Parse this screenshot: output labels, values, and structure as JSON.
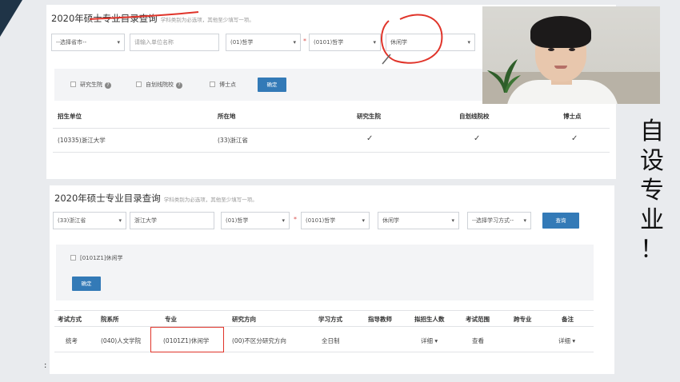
{
  "panel1": {
    "title": "2020年硕士专业目录查询",
    "subtitle": "学科类别为必选项，其他至少填写一项。",
    "province_select": "--选择省市--",
    "unit_input_placeholder": "请输入单位名称",
    "discipline_select": "(01)哲学",
    "subject_select": "(0101)哲学",
    "major_input": "休闲学",
    "checkboxes": [
      {
        "label": "研究生院",
        "help": "?"
      },
      {
        "label": "自划线院校",
        "help": "?"
      },
      {
        "label": "博士点",
        "help": ""
      }
    ],
    "confirm_button": "确定",
    "table": {
      "headers": [
        "招生单位",
        "所在地",
        "研究生院",
        "自划线院校",
        "博士点"
      ],
      "rows": [
        {
          "unit": "(10335)浙江大学",
          "location": "(33)浙江省",
          "c1": "✓",
          "c2": "✓",
          "c3": "✓"
        }
      ]
    }
  },
  "panel2": {
    "title": "2020年硕士专业目录查询",
    "subtitle": "学科类别为必选项，其他至少填写一项。",
    "province_select": "(33)浙江省",
    "unit_input": "浙江大学",
    "discipline_select": "(01)哲学",
    "subject_select": "(0101)哲学",
    "major_select": "休闲学",
    "study_mode_select": "--选择学习方式--",
    "query_button": "查询",
    "major_checkbox": "[0101Z1]休闲学",
    "confirm_button": "确定",
    "table": {
      "headers": [
        "考试方式",
        "院系所",
        "专业",
        "研究方向",
        "学习方式",
        "指导教师",
        "拟招生人数",
        "考试范围",
        "跨专业",
        "备注"
      ],
      "row": {
        "exam": "统考",
        "dept": "(040)人文学院",
        "major": "(0101Z1)休闲学",
        "direction": "(00)不区分研究方向",
        "mode": "全日制",
        "advisor": "",
        "quota": "详细",
        "scope": "查看",
        "cross": "",
        "remark": "详细"
      }
    }
  },
  "side_caption": [
    "自",
    "设",
    "专",
    "业",
    "！"
  ],
  "colors": {
    "accent": "#337ab7",
    "annotation": "#e0342a"
  }
}
